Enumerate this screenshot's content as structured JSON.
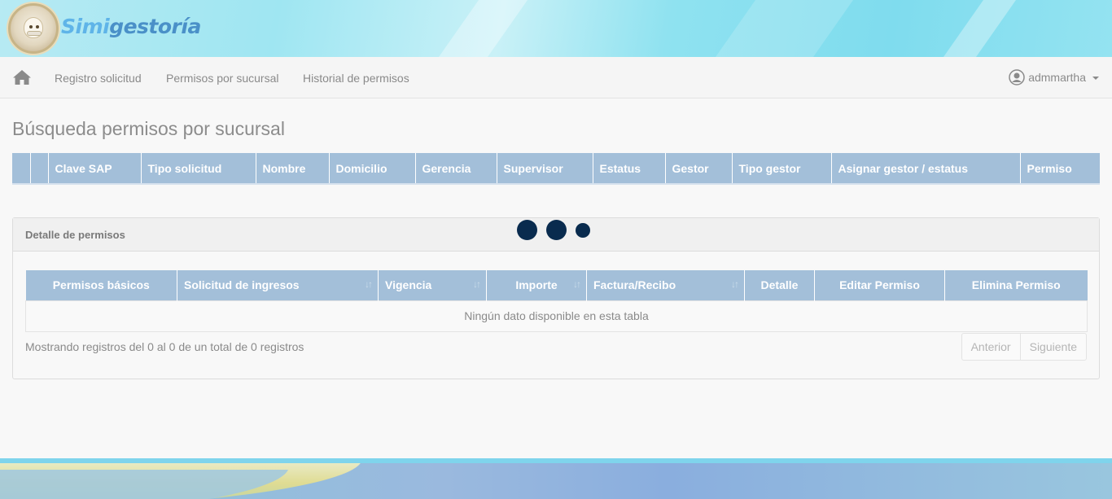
{
  "brand": {
    "part1": "Simi",
    "part2": "gestoría"
  },
  "nav": {
    "links": [
      "Registro solicitud",
      "Permisos por sucursal",
      "Historial de permisos"
    ],
    "user": "admmartha"
  },
  "page": {
    "title": "Búsqueda permisos por sucursal"
  },
  "main_table": {
    "headers": [
      "",
      "",
      "Clave SAP",
      "Tipo solicitud",
      "Nombre",
      "Domicilio",
      "Gerencia",
      "Supervisor",
      "Estatus",
      "Gestor",
      "Tipo gestor",
      "Asignar gestor / estatus",
      "Permiso"
    ]
  },
  "detail_panel": {
    "title": "Detalle de permisos",
    "headers": [
      "Permisos básicos",
      "Solicitud de ingresos",
      "Vigencia",
      "Importe",
      "Factura/Recibo",
      "Detalle",
      "Editar Permiso",
      "Elimina Permiso"
    ],
    "empty_message": "Ningún dato disponible en esta tabla",
    "info": "Mostrando registros del 0 al 0 de un total de 0 registros",
    "pager": {
      "previous": "Anterior",
      "next": "Siguiente"
    }
  },
  "colors": {
    "table_header": "#a3bfd9",
    "loader_dot": "#092b4e"
  },
  "icons": [
    "home-icon",
    "user-circle-icon",
    "caret-down-icon",
    "sort-icon"
  ]
}
